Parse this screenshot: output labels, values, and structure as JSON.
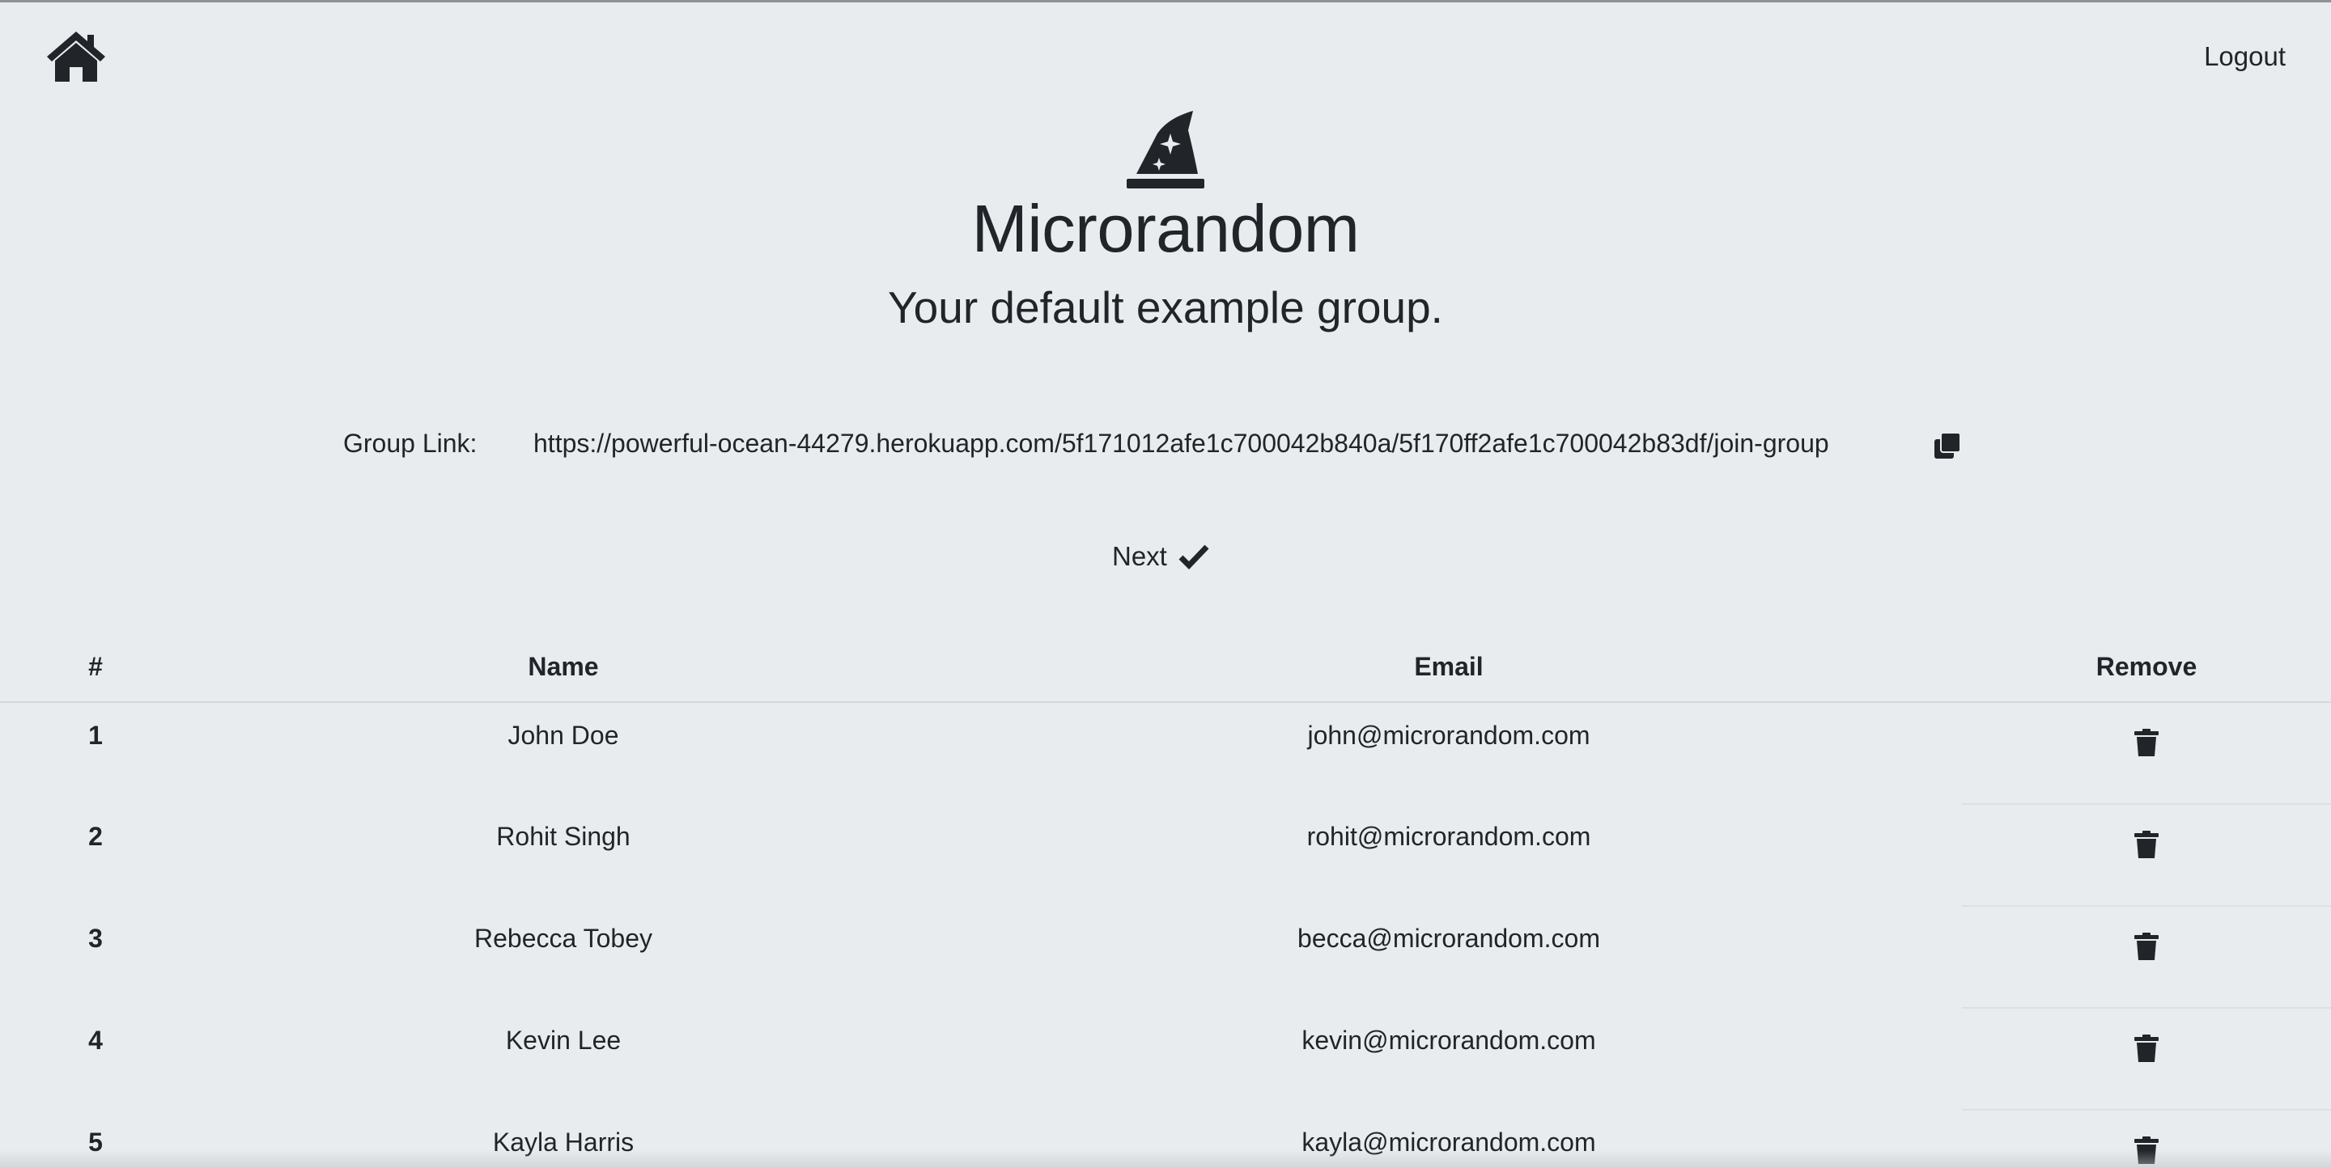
{
  "nav": {
    "home_icon": "home-icon",
    "logout_label": "Logout"
  },
  "brand": {
    "logo_icon": "wizard-hat-icon",
    "title": "Microrandom",
    "subtitle": "Your default example group."
  },
  "group_link": {
    "label": "Group Link:",
    "url": "https://powerful-ocean-44279.herokuapp.com/5f171012afe1c700042b840a/5f170ff2afe1c700042b83df/join-group",
    "copy_icon": "copy-icon"
  },
  "next": {
    "label": "Next",
    "icon": "check-icon"
  },
  "table": {
    "headers": {
      "num": "#",
      "name": "Name",
      "email": "Email",
      "remove": "Remove"
    },
    "rows": [
      {
        "num": "1",
        "name": "John Doe",
        "email": "john@microrandom.com"
      },
      {
        "num": "2",
        "name": "Rohit Singh",
        "email": "rohit@microrandom.com"
      },
      {
        "num": "3",
        "name": "Rebecca Tobey",
        "email": "becca@microrandom.com"
      },
      {
        "num": "4",
        "name": "Kevin Lee",
        "email": "kevin@microrandom.com"
      },
      {
        "num": "5",
        "name": "Kayla Harris",
        "email": "kayla@microrandom.com"
      }
    ],
    "remove_icon": "trash-icon"
  },
  "colors": {
    "background": "#e9ecef",
    "text": "#212529"
  }
}
